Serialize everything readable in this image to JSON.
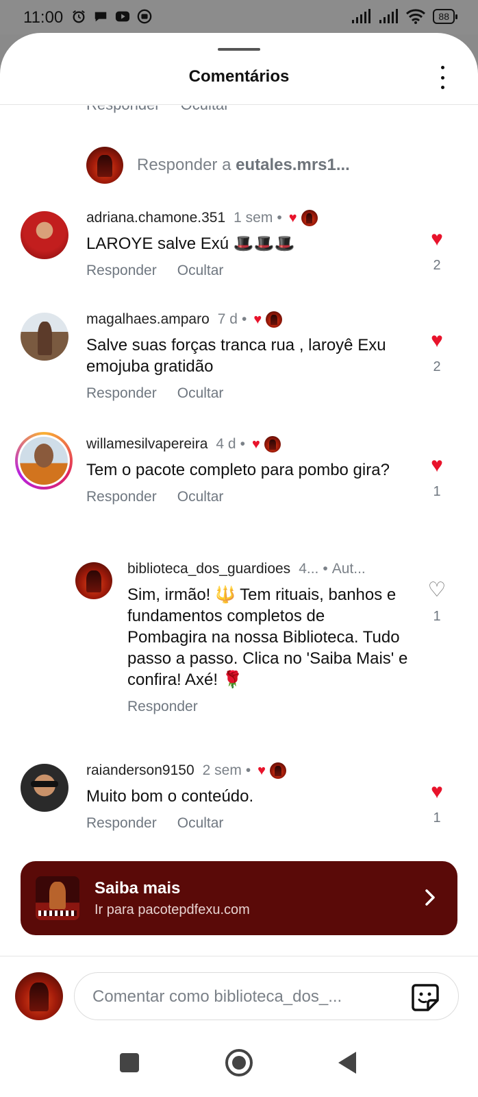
{
  "status_bar": {
    "time": "11:00",
    "battery": "88"
  },
  "header": {
    "title": "Comentários"
  },
  "cut_actions": {
    "reply": "Responder",
    "hide": "Ocultar"
  },
  "reply_prompt": {
    "prefix": "Responder a ",
    "username": "eutales.mrs1..."
  },
  "comments": [
    {
      "username": "adriana.chamone.351",
      "time": "1 sem",
      "text": "LAROYE salve Exú 🎩🎩🎩",
      "reply_label": "Responder",
      "hide_label": "Ocultar",
      "like_count": "2"
    },
    {
      "username": "magalhaes.amparo",
      "time": "7 d",
      "text": "Salve suas forças tranca rua , laroyê Exu emojuba gratidão",
      "reply_label": "Responder",
      "hide_label": "Ocultar",
      "like_count": "2"
    },
    {
      "username": "willamesilvapereira",
      "time": "4 d",
      "text": "Tem o pacote completo para pombo gira?",
      "reply_label": "Responder",
      "hide_label": "Ocultar",
      "like_count": "1"
    },
    {
      "username": "biblioteca_dos_guardioes",
      "time": "4...",
      "badge": "Aut...",
      "text": "Sim, irmão! 🔱 Tem rituais, banhos e fundamentos completos de Pombagira na nossa Biblioteca. Tudo passo a passo. Clica no 'Saiba Mais' e confira! Axé! 🌹",
      "reply_label": "Responder",
      "like_count": "1"
    },
    {
      "username": "raianderson9150",
      "time": "2 sem",
      "text": "Muito bom o conteúdo.",
      "reply_label": "Responder",
      "hide_label": "Ocultar",
      "like_count": "1"
    }
  ],
  "saiba_mais": {
    "title": "Saiba mais",
    "subtitle": "Ir para pacotepdfexu.com"
  },
  "composer": {
    "placeholder": "Comentar como biblioteca_dos_..."
  },
  "colors": {
    "heart": "#e8132b",
    "banner": "#5a0a08",
    "muted": "#6f7780"
  }
}
